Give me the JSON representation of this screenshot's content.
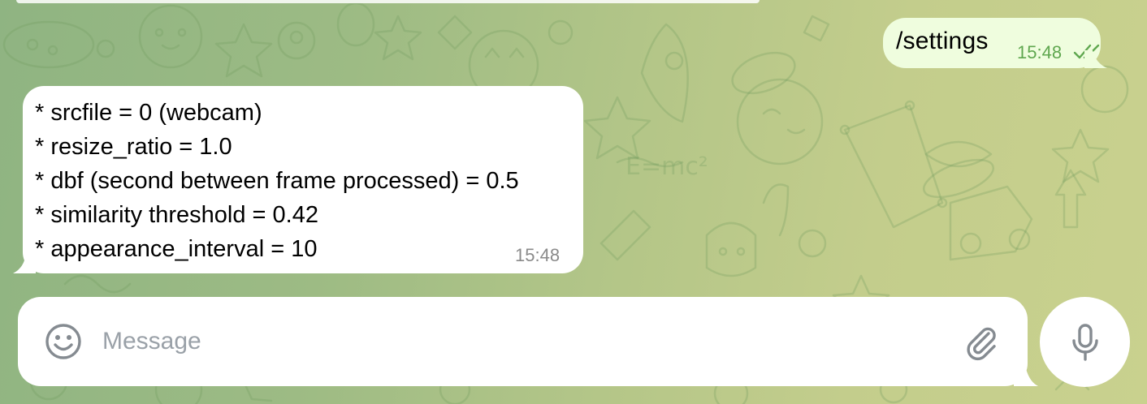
{
  "chat": {
    "outgoing": {
      "text": "/settings",
      "time": "15:48",
      "status_icon": "double-check-icon"
    },
    "incoming": {
      "lines": [
        "* srcfile = 0 (webcam)",
        "* resize_ratio = 1.0",
        "* dbf (second between frame processed) = 0.5",
        "* similarity threshold = 0.42",
        "* appearance_interval = 10"
      ],
      "time": "15:48"
    }
  },
  "composer": {
    "placeholder": "Message",
    "value": "",
    "emoji_icon": "smiley-icon",
    "attach_icon": "paperclip-icon",
    "mic_icon": "microphone-icon"
  },
  "colors": {
    "outgoing_bubble": "#effdde",
    "incoming_bubble": "#ffffff",
    "outgoing_time": "#5fa74f",
    "incoming_time": "#8a8a8a",
    "icon_gray": "#858b91",
    "placeholder": "#9aa1a8"
  }
}
